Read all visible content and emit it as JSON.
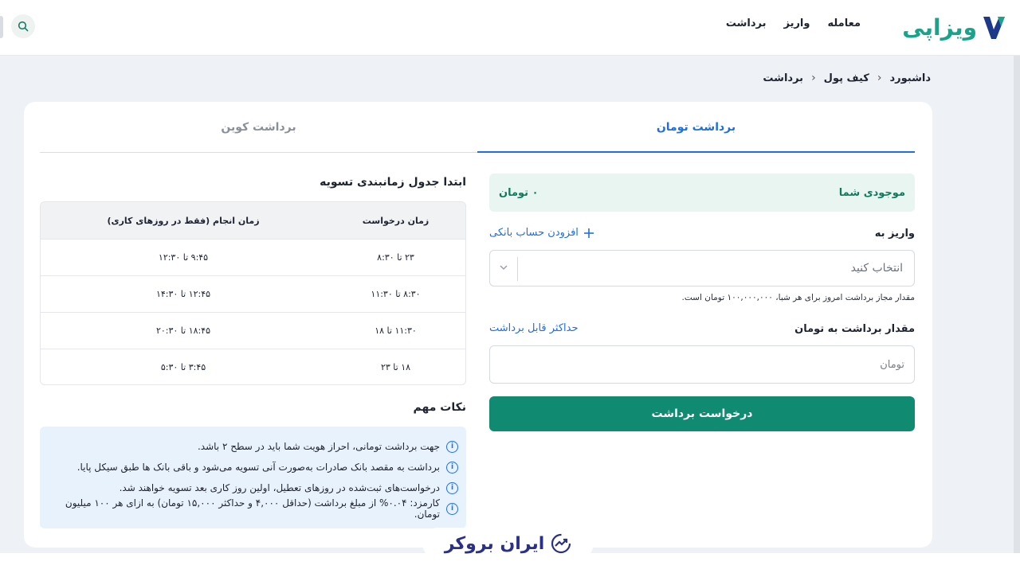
{
  "header": {
    "logo_text": "ویزاپی",
    "nav": [
      "معامله",
      "واریز",
      "برداشت"
    ]
  },
  "breadcrumb": [
    "داشبورد",
    "کیف پول",
    "برداشت"
  ],
  "tabs": {
    "toman": "برداشت تومان",
    "coin": "برداشت کوین"
  },
  "form": {
    "balance_label": "موجودی شما",
    "balance_value": "۰ تومان",
    "deposit_to_label": "واریز به",
    "add_bank_account": "افزودن حساب بانکی",
    "select_placeholder": "انتخاب کنید",
    "limit_hint": "مقدار مجاز برداشت امروز برای هر شبا، ۱۰۰,۰۰۰,۰۰۰ تومان است.",
    "amount_label": "مقدار برداشت به تومان",
    "max_link": "حداکثر قابل برداشت",
    "amount_placeholder": "تومان",
    "submit": "درخواست برداشت"
  },
  "schedule": {
    "title": "ابتدا جدول زمانبندی تسویه",
    "headers": [
      "زمان درخواست",
      "زمان انجام (فقط در روزهای کاری)"
    ],
    "rows": [
      [
        "۲۳ تا ۸:۳۰",
        "۹:۴۵ تا ۱۲:۳۰"
      ],
      [
        "۸:۳۰ تا ۱۱:۳۰",
        "۱۲:۴۵ تا ۱۴:۳۰"
      ],
      [
        "۱۱:۳۰ تا ۱۸",
        "۱۸:۴۵ تا ۲۰:۳۰"
      ],
      [
        "۱۸ تا ۲۳",
        "۳:۴۵ تا ۵:۳۰"
      ]
    ]
  },
  "notes": {
    "title": "نکات مهم",
    "items": [
      "جهت برداشت تومانی، احراز هویت شما باید در سطح ۲ باشد.",
      "برداشت به مقصد بانک صادرات به‌صورت آنی تسویه می‌شود و باقی بانک ها طبق سیکل پایا.",
      "درخواست‌های ثبت‌شده در روزهای تعطیل، اولین روز کاری بعد تسویه خواهند شد.",
      "کارمزد: ۰.۰۴% از مبلغ برداشت (حداقل ۴,۰۰۰ و حداکثر ۱۵,۰۰۰ تومان) به ازای هر ۱۰۰ میلیون تومان."
    ]
  },
  "watermark": "ایران بروکر",
  "colors": {
    "accent": "#1f6fe0",
    "brand": "#118a72",
    "balance_bg": "#e9f5f1",
    "notes_bg": "#e8f2fc"
  }
}
